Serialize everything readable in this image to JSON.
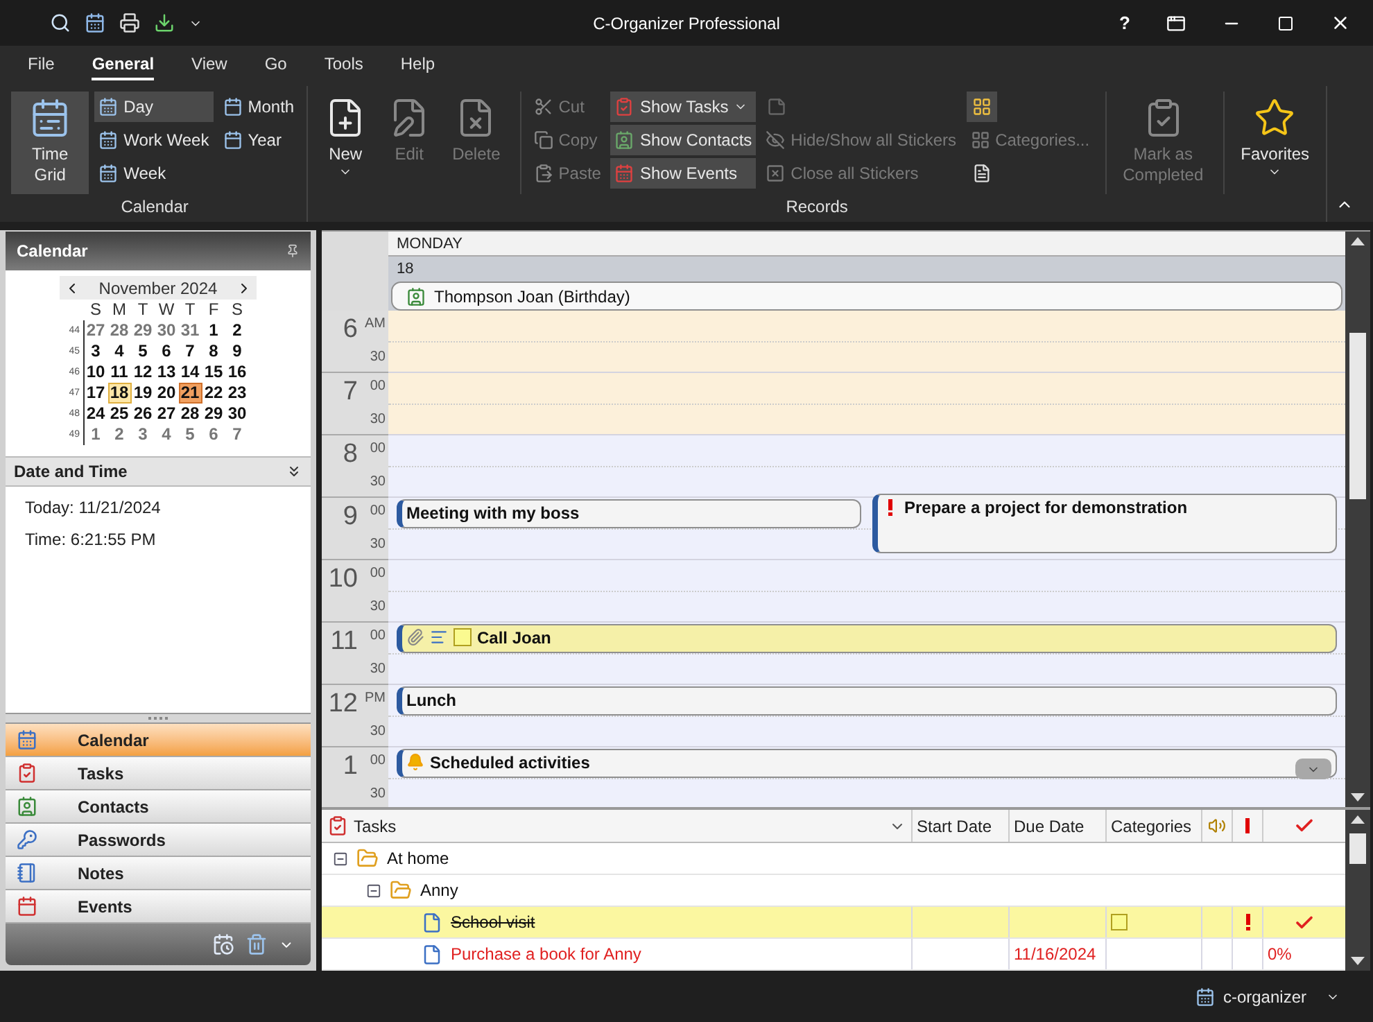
{
  "window": {
    "title": "C-Organizer Professional",
    "help": "?"
  },
  "menu": [
    {
      "label": "File",
      "selected": false
    },
    {
      "label": "General",
      "selected": true
    },
    {
      "label": "View",
      "selected": false
    },
    {
      "label": "Go",
      "selected": false
    },
    {
      "label": "Tools",
      "selected": false
    },
    {
      "label": "Help",
      "selected": false
    }
  ],
  "ribbon": [
    {
      "label": "Calendar",
      "columns": [
        [
          {
            "kind": "large",
            "label": "Time Grid",
            "selected": true,
            "disabled": false
          }
        ],
        [
          {
            "kind": "small",
            "label": "Day",
            "selected": true,
            "disabled": false
          },
          {
            "kind": "small",
            "label": "Work Week",
            "selected": false,
            "disabled": false
          },
          {
            "kind": "small",
            "label": "Week",
            "selected": false,
            "disabled": false
          }
        ],
        [
          {
            "kind": "small",
            "label": "Month",
            "selected": false,
            "disabled": false
          },
          {
            "kind": "small",
            "label": "Year",
            "selected": false,
            "disabled": false
          }
        ]
      ]
    },
    {
      "label": "Records",
      "columns": [
        [
          {
            "kind": "large",
            "label": "New",
            "disabled": false,
            "dropdown": true
          }
        ],
        [
          {
            "kind": "large",
            "label": "Edit",
            "disabled": true
          }
        ],
        [
          {
            "kind": "large",
            "label": "Delete",
            "disabled": true
          }
        ],
        [
          {
            "kind": "small",
            "label": "Cut",
            "disabled": true
          },
          {
            "kind": "small",
            "label": "Copy",
            "disabled": true
          },
          {
            "kind": "small",
            "label": "Paste",
            "disabled": true
          }
        ],
        [
          {
            "kind": "small",
            "label": "Show Tasks",
            "selected": true,
            "disabled": false,
            "dropdown": true
          },
          {
            "kind": "small",
            "label": "Show Contacts",
            "selected": true,
            "disabled": false
          },
          {
            "kind": "small",
            "label": "Show Events",
            "selected": true,
            "disabled": false
          }
        ],
        [
          {
            "kind": "icon",
            "disabled": true
          },
          {
            "kind": "small",
            "label": "Hide/Show all Stickers",
            "disabled": true
          },
          {
            "kind": "small",
            "label": "Close all Stickers",
            "disabled": true
          }
        ],
        [
          {
            "kind": "icon",
            "selected": true,
            "disabled": false
          },
          {
            "kind": "small",
            "label": "Categories...",
            "disabled": true
          },
          {
            "kind": "icon",
            "disabled": false
          }
        ],
        [
          {
            "kind": "large",
            "label": "Mark as Completed",
            "disabled": true
          }
        ],
        [
          {
            "kind": "large",
            "label": "Favorites",
            "disabled": false,
            "dropdown": true
          }
        ]
      ]
    }
  ],
  "calendar": {
    "title": "Calendar",
    "month": "November 2024",
    "weekdays": [
      "S",
      "M",
      "T",
      "W",
      "T",
      "F",
      "S"
    ],
    "weeks": [
      {
        "number": "44",
        "days": [
          {
            "day": "27",
            "other_month": true,
            "selected": false,
            "today": false
          },
          {
            "day": "28",
            "other_month": true,
            "selected": false,
            "today": false
          },
          {
            "day": "29",
            "other_month": true,
            "selected": false,
            "today": false
          },
          {
            "day": "30",
            "other_month": true,
            "selected": false,
            "today": false
          },
          {
            "day": "31",
            "other_month": true,
            "selected": false,
            "today": false
          },
          {
            "day": "1",
            "other_month": false,
            "selected": false,
            "today": false
          },
          {
            "day": "2",
            "other_month": false,
            "selected": false,
            "today": false
          }
        ]
      },
      {
        "number": "45",
        "days": [
          {
            "day": "3",
            "other_month": false,
            "selected": false,
            "today": false
          },
          {
            "day": "4",
            "other_month": false,
            "selected": false,
            "today": false
          },
          {
            "day": "5",
            "other_month": false,
            "selected": false,
            "today": false
          },
          {
            "day": "6",
            "other_month": false,
            "selected": false,
            "today": false
          },
          {
            "day": "7",
            "other_month": false,
            "selected": false,
            "today": false
          },
          {
            "day": "8",
            "other_month": false,
            "selected": false,
            "today": false
          },
          {
            "day": "9",
            "other_month": false,
            "selected": false,
            "today": false
          }
        ]
      },
      {
        "number": "46",
        "days": [
          {
            "day": "10",
            "other_month": false,
            "selected": false,
            "today": false
          },
          {
            "day": "11",
            "other_month": false,
            "selected": false,
            "today": false
          },
          {
            "day": "12",
            "other_month": false,
            "selected": false,
            "today": false
          },
          {
            "day": "13",
            "other_month": false,
            "selected": false,
            "today": false
          },
          {
            "day": "14",
            "other_month": false,
            "selected": false,
            "today": false
          },
          {
            "day": "15",
            "other_month": false,
            "selected": false,
            "today": false
          },
          {
            "day": "16",
            "other_month": false,
            "selected": false,
            "today": false
          }
        ]
      },
      {
        "number": "47",
        "days": [
          {
            "day": "17",
            "other_month": false,
            "selected": false,
            "today": false
          },
          {
            "day": "18",
            "other_month": false,
            "selected": true,
            "today": false
          },
          {
            "day": "19",
            "other_month": false,
            "selected": false,
            "today": false
          },
          {
            "day": "20",
            "other_month": false,
            "selected": false,
            "today": false
          },
          {
            "day": "21",
            "other_month": false,
            "selected": false,
            "today": true
          },
          {
            "day": "22",
            "other_month": false,
            "selected": false,
            "today": false
          },
          {
            "day": "23",
            "other_month": false,
            "selected": false,
            "today": false
          }
        ]
      },
      {
        "number": "48",
        "days": [
          {
            "day": "24",
            "other_month": false,
            "selected": false,
            "today": false
          },
          {
            "day": "25",
            "other_month": false,
            "selected": false,
            "today": false
          },
          {
            "day": "26",
            "other_month": false,
            "selected": false,
            "today": false
          },
          {
            "day": "27",
            "other_month": false,
            "selected": false,
            "today": false
          },
          {
            "day": "28",
            "other_month": false,
            "selected": false,
            "today": false
          },
          {
            "day": "29",
            "other_month": false,
            "selected": false,
            "today": false
          },
          {
            "day": "30",
            "other_month": false,
            "selected": false,
            "today": false
          }
        ]
      },
      {
        "number": "49",
        "days": [
          {
            "day": "1",
            "other_month": true,
            "selected": false,
            "today": false
          },
          {
            "day": "2",
            "other_month": true,
            "selected": false,
            "today": false
          },
          {
            "day": "3",
            "other_month": true,
            "selected": false,
            "today": false
          },
          {
            "day": "4",
            "other_month": true,
            "selected": false,
            "today": false
          },
          {
            "day": "5",
            "other_month": true,
            "selected": false,
            "today": false
          },
          {
            "day": "6",
            "other_month": true,
            "selected": false,
            "today": false
          },
          {
            "day": "7",
            "other_month": true,
            "selected": false,
            "today": false
          }
        ]
      }
    ]
  },
  "date_and_time": {
    "title": "Date and Time",
    "lines": [
      "Today: 11/21/2024",
      "Time: 6:21:55 PM"
    ]
  },
  "navigation": [
    {
      "label": "Calendar",
      "selected": true
    },
    {
      "label": "Tasks",
      "selected": false
    },
    {
      "label": "Contacts",
      "selected": false
    },
    {
      "label": "Passwords",
      "selected": false
    },
    {
      "label": "Notes",
      "selected": false
    },
    {
      "label": "Events",
      "selected": false
    }
  ],
  "day_view": {
    "weekday": "MONDAY",
    "date": "18",
    "all_day": [
      {
        "title": "Thompson Joan (Birthday)"
      }
    ],
    "time_slots": [
      {
        "hour": "6",
        "suffix": "AM",
        "half": "30",
        "working": false
      },
      {
        "hour": "7",
        "suffix": "00",
        "half": "30",
        "working": false
      },
      {
        "hour": "8",
        "suffix": "00",
        "half": "30",
        "working": true
      },
      {
        "hour": "9",
        "suffix": "00",
        "half": "30",
        "working": true,
        "events": [
          {
            "kind": "appointment",
            "title": "Meeting with my boss",
            "color": "#f4f4f4"
          },
          {
            "kind": "task",
            "title": "Prepare a project for demonstration",
            "color": "#f4f4f4",
            "important": true
          }
        ]
      },
      {
        "hour": "10",
        "suffix": "00",
        "half": "30",
        "working": true
      },
      {
        "hour": "11",
        "suffix": "00",
        "half": "30",
        "working": true,
        "events": [
          {
            "kind": "appointment",
            "title": "Call Joan",
            "color": "#f5f0a8",
            "attachment": true,
            "note": true,
            "category": true
          }
        ]
      },
      {
        "hour": "12",
        "suffix": "PM",
        "half": "30",
        "working": true,
        "events": [
          {
            "kind": "appointment",
            "title": "Lunch",
            "color": "#f4f4f4"
          }
        ]
      },
      {
        "hour": "1",
        "suffix": "00",
        "half": "30",
        "working": true,
        "events": [
          {
            "kind": "appointment",
            "title": "Scheduled activities",
            "color": "#f4f4f4",
            "reminder": true,
            "expandable": true
          }
        ]
      }
    ]
  },
  "tasks": {
    "columns": [
      "Tasks",
      "Start Date",
      "Due Date",
      "Categories"
    ],
    "rows": [
      {
        "kind": "group",
        "label": "At home",
        "expanded": true,
        "children": [
          {
            "kind": "group",
            "label": "Anny",
            "expanded": true,
            "children": [
              {
                "kind": "task",
                "label": "School visit",
                "selected": true,
                "completed": true,
                "overdue": false,
                "category": true,
                "important": true
              },
              {
                "kind": "task",
                "label": "Purchase a book for Anny",
                "selected": false,
                "completed": false,
                "overdue": true,
                "due_date": "11/16/2024",
                "category": false,
                "important": false,
                "progress": "0%"
              }
            ]
          }
        ]
      }
    ]
  },
  "status_bar": {
    "label": "c-organizer"
  }
}
